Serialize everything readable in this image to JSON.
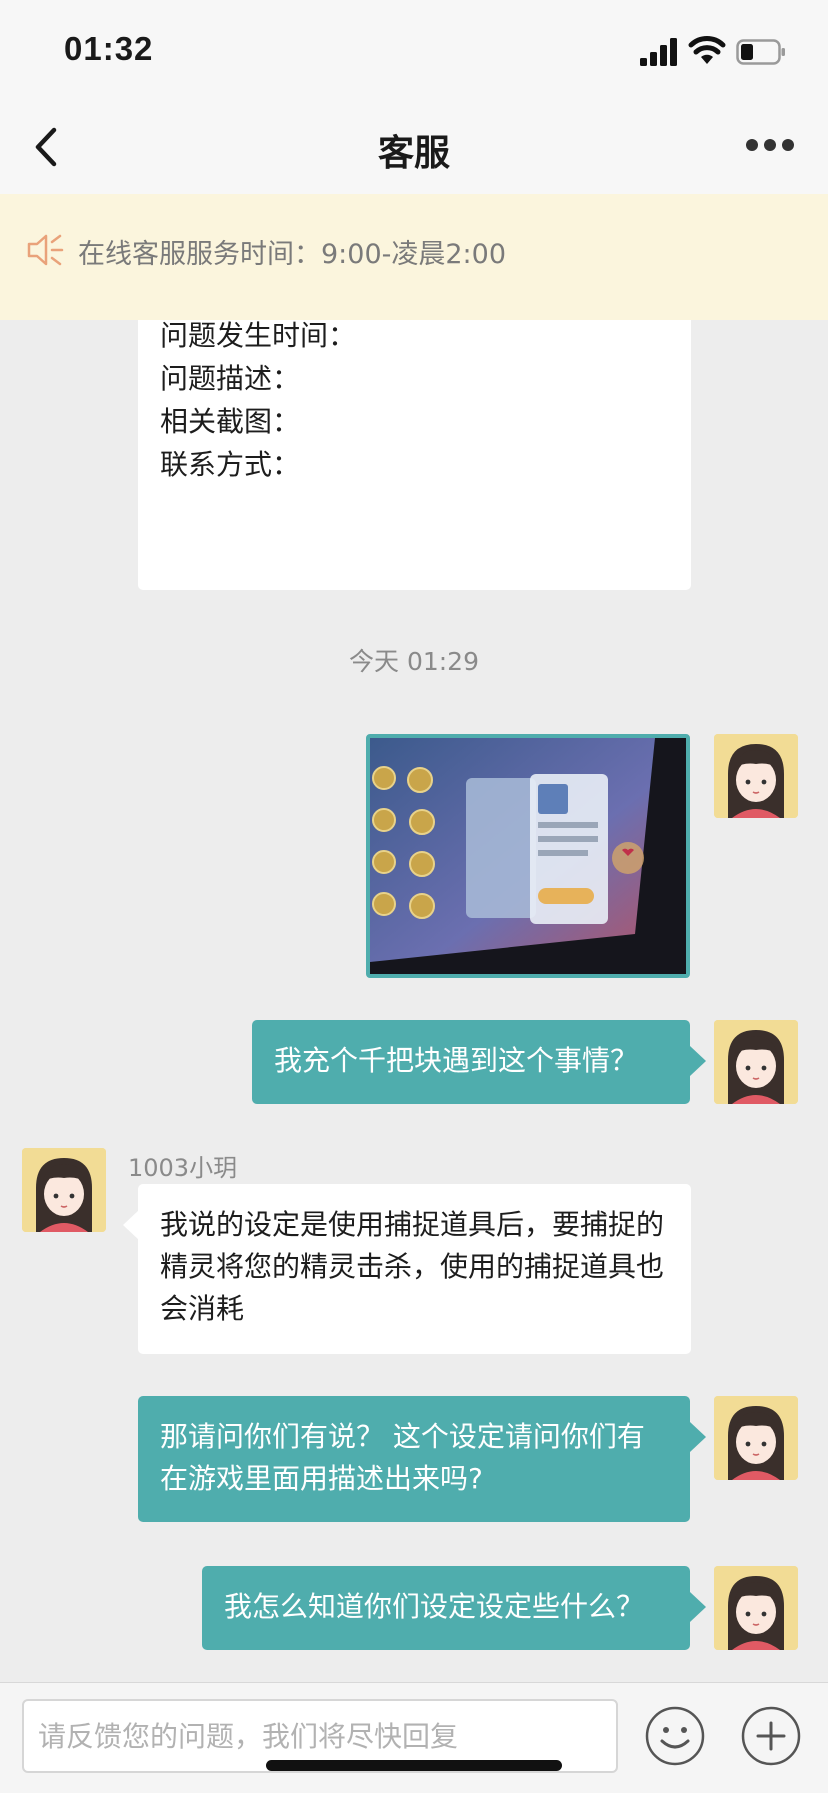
{
  "status_bar": {
    "time": "01:32"
  },
  "nav": {
    "title": "客服"
  },
  "notice": {
    "text": "在线客服服务时间：9:00-凌晨2:00"
  },
  "chat": {
    "form_card": {
      "lines": [
        "问题发生时间：",
        "问题描述：",
        "相关截图：",
        "联系方式："
      ]
    },
    "timestamp": "今天 01:29",
    "messages": [
      {
        "from": "user",
        "text": "我充个千把块遇到这个事情？"
      },
      {
        "from": "agent",
        "sender": "1003小玥",
        "text": "我说的设定是使用捕捉道具后，要捕捉的精灵将您的精灵击杀，使用的捕捉道具也会消耗"
      },
      {
        "from": "user",
        "text": "那请问你们有说？ 这个设定请问你们有在游戏里面用描述出来吗?"
      },
      {
        "from": "user",
        "text": "我怎么知道你们设定设定些什么？"
      }
    ]
  },
  "input": {
    "placeholder": "请反馈您的问题，我们将尽快回复"
  },
  "colors": {
    "accent": "#4fadad",
    "notice_bg": "#fbf5dd",
    "chat_bg": "#ededed"
  }
}
